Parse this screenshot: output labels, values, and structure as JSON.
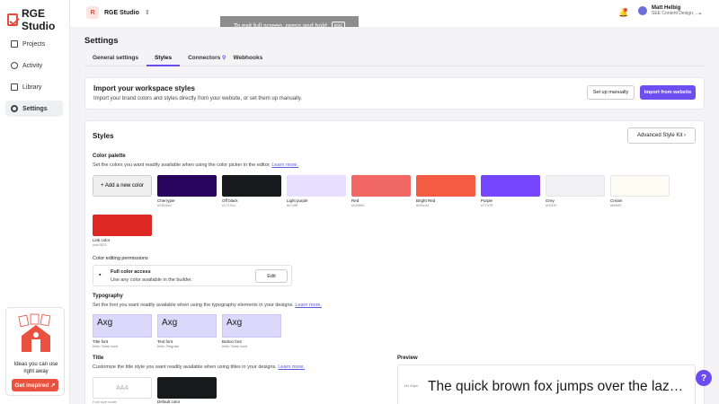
{
  "app": {
    "name": "RGE Studio"
  },
  "sidebar": {
    "items": [
      {
        "label": "Projects",
        "icon": "folder-icon"
      },
      {
        "label": "Activity",
        "icon": "activity-icon"
      },
      {
        "label": "Library",
        "icon": "book-icon"
      },
      {
        "label": "Settings",
        "icon": "gear-icon",
        "active": true
      }
    ],
    "promo": {
      "text": "Ideas you can use right away",
      "button": "Get inspired ↗"
    }
  },
  "topbar": {
    "workspace_initial": "R",
    "workspace_name": "RGE Studio",
    "fullscreen_hint": "To exit full screen, press and hold",
    "fullscreen_key": "esc",
    "user_name": "Matt Helbig",
    "user_role": "SEE Content Design, ..."
  },
  "page": {
    "title": "Settings",
    "tabs": [
      "General settings",
      "Styles",
      "Connectors",
      "Webhooks"
    ],
    "active_tab": "Styles"
  },
  "import": {
    "title": "Import your workspace styles",
    "description": "Import your brand colors and styles directly from your website, or set them up manually.",
    "setup_button": "Set up manually",
    "import_button": "Import from website"
  },
  "styles": {
    "title": "Styles",
    "kit_button": "Advanced Style Kit",
    "palette_title": "Color palette",
    "palette_desc": "Set the colors you want readily available when using the color picker in the editor.",
    "learn_more": "Learn more.",
    "add_color": "+ Add a new color",
    "colors": [
      {
        "name": "Cherrypie",
        "hex": "#28045d"
      },
      {
        "name": "Off black",
        "hex": "#17191c"
      },
      {
        "name": "Light purple",
        "hex": "#e7dfff"
      },
      {
        "name": "Red",
        "hex": "#f26864"
      },
      {
        "name": "Bright Red",
        "hex": "#f45c44"
      },
      {
        "name": "Purple",
        "hex": "#7747ff"
      },
      {
        "name": "Grey",
        "hex": "#f1f1f3"
      },
      {
        "name": "Cream",
        "hex": "#fefbf3"
      },
      {
        "name": "Link color",
        "hex": "#de2823"
      }
    ],
    "perm_title": "Color editing permissions",
    "perm_name": "Full color access",
    "perm_desc": "Use any color available in the builder.",
    "perm_edit": "Edit",
    "typo_title": "Typography",
    "typo_desc": "Set the font you want readily available when using the typography elements in your designs.",
    "fonts": [
      {
        "sample": "Axg",
        "name": "Title font",
        "sub": "Inter, Semi bold"
      },
      {
        "sample": "Axg",
        "name": "Text font",
        "sub": "Inter, Regular"
      },
      {
        "sample": "Axg",
        "name": "Button font",
        "sub": "Inter, Semi bold"
      }
    ],
    "title_section": "Title",
    "title_desc": "Customize the title style you want readily available when using titles in your designs.",
    "title_sample": "AAA",
    "font_scale_label": "Font size scale",
    "default_color_label": "Default color",
    "preview_label": "Preview",
    "preview_size": "H1 40px",
    "preview_text": "The quick brown fox jumps over the laz…"
  },
  "help": "?"
}
